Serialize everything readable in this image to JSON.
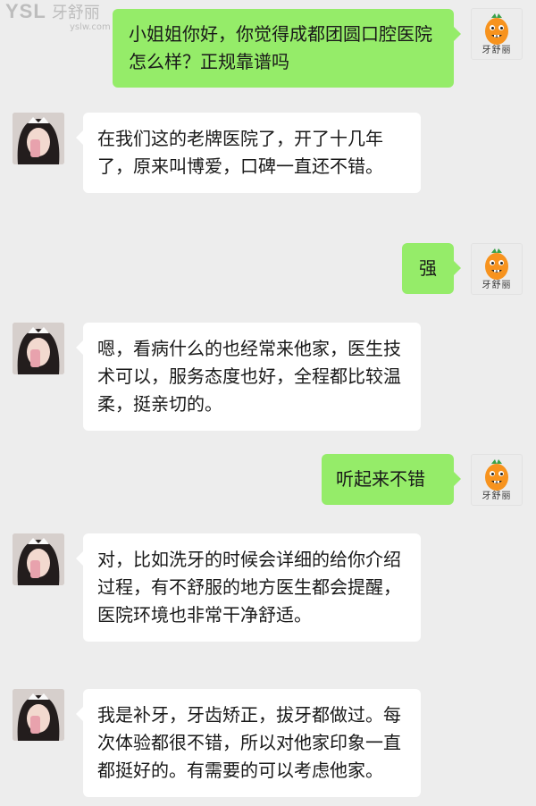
{
  "watermark": {
    "logo": "YSL",
    "brand": "牙舒丽",
    "url": "yslw.com",
    "center_brand": "牙舒丽",
    "center_url": "yslw.com"
  },
  "colors": {
    "background": "#ededed",
    "sent_bubble": "#95ec69",
    "received_bubble": "#ffffff"
  },
  "avatars": {
    "self_label": "牙舒丽",
    "self_icon": "carrot-mascot-icon",
    "contact_icon": "girl-photo-avatar"
  },
  "messages": [
    {
      "direction": "out",
      "text": "小姐姐你好，你觉得成都团圆口腔医院怎么样？正规靠谱吗"
    },
    {
      "direction": "in",
      "text": "在我们这的老牌医院了，开了十几年了，原来叫博爱，口碑一直还不错。"
    },
    {
      "direction": "out",
      "text": "强"
    },
    {
      "direction": "in",
      "text": "嗯，看病什么的也经常来他家，医生技术可以，服务态度也好，全程都比较温柔，挺亲切的。"
    },
    {
      "direction": "out",
      "text": "听起来不错"
    },
    {
      "direction": "in",
      "text": "对，比如洗牙的时候会详细的给你介绍过程，有不舒服的地方医生都会提醒，医院环境也非常干净舒适。"
    },
    {
      "direction": "in",
      "text": "我是补牙，牙齿矫正，拔牙都做过。每次体验都很不错，所以对他家印象一直都挺好的。有需要的可以考虑他家。"
    }
  ]
}
